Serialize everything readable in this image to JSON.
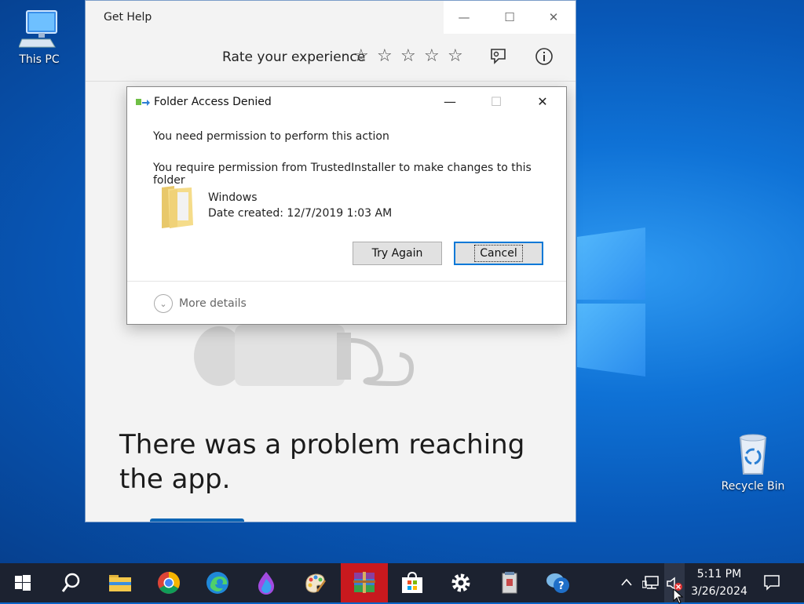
{
  "desktop": {
    "icons": [
      {
        "label": "This PC"
      },
      {
        "label": "Recycle Bin"
      }
    ]
  },
  "gethelp": {
    "title": "Get Help",
    "rate_label": "Rate your experience",
    "stars": [
      "☆",
      "☆",
      "☆",
      "☆",
      "☆"
    ],
    "problem_message": "There was a problem reaching the app.",
    "caption": {
      "minimize": "—",
      "maximize": "☐",
      "close": "✕"
    }
  },
  "dialog": {
    "title": "Folder Access Denied",
    "message_main": "You need permission to perform this action",
    "message_detail": "You require permission from TrustedInstaller to make changes to this folder",
    "item_name": "Windows",
    "item_date": "Date created: 12/7/2019 1:03 AM",
    "try_again_label": "Try Again",
    "cancel_label": "Cancel",
    "more_details_label": "More details",
    "caption": {
      "minimize": "—",
      "maximize": "☐",
      "close": "✕"
    }
  },
  "taskbar": {
    "apps": [
      {
        "name": "start-icon"
      },
      {
        "name": "search-icon"
      },
      {
        "name": "file-explorer-icon"
      },
      {
        "name": "chrome-icon"
      },
      {
        "name": "edge-icon"
      },
      {
        "name": "paint-drop-icon"
      },
      {
        "name": "paint-palette-icon"
      },
      {
        "name": "winrar-icon"
      },
      {
        "name": "store-icon"
      },
      {
        "name": "settings-icon"
      },
      {
        "name": "notepad-icon"
      },
      {
        "name": "get-help-icon"
      }
    ],
    "clock_time": "5:11 PM",
    "clock_date": "3/26/2024",
    "colors": {
      "taskbar": "#1c2230",
      "active_app": "#c8191e",
      "accent": "#0078d7"
    }
  }
}
